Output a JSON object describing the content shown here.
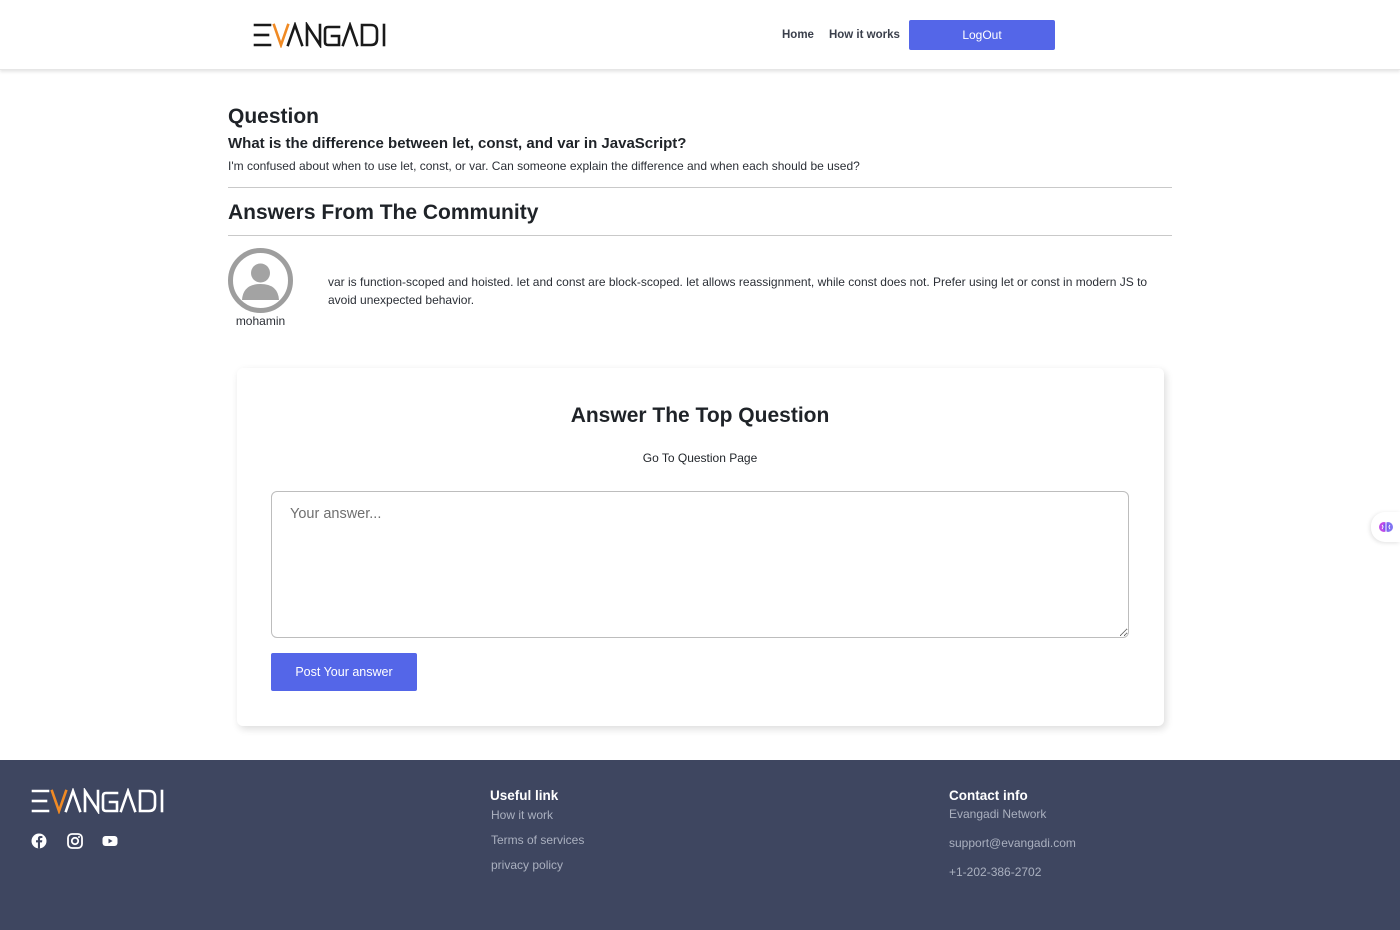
{
  "header": {
    "logo_text": "EVANGADI",
    "nav": {
      "home": "Home",
      "how_it_works": "How it works"
    },
    "logout_label": "LogOut"
  },
  "question": {
    "heading": "Question",
    "title": "What is the difference between let, const, and var in JavaScript?",
    "description": "I'm confused about when to use let, const, or var. Can someone explain the difference and when each should be used?"
  },
  "answers": {
    "heading": "Answers From The Community",
    "items": [
      {
        "username": "mohamin",
        "text": "var is function-scoped and hoisted. let and const are block-scoped. let allows reassignment, while const does not. Prefer using let or const in modern JS to avoid unexpected behavior."
      }
    ]
  },
  "answer_form": {
    "title": "Answer The Top Question",
    "link": "Go To Question Page",
    "placeholder": "Your answer...",
    "submit_label": "Post Your answer"
  },
  "footer": {
    "logo_text": "EVANGADI",
    "social_icons": [
      "facebook-icon",
      "instagram-icon",
      "youtube-icon"
    ],
    "useful_links": {
      "title": "Useful link",
      "items": [
        "How it work",
        "Terms of services",
        "privacy policy"
      ]
    },
    "contact": {
      "title": "Contact info",
      "items": [
        "Evangadi Network",
        "support@evangadi.com",
        "+1-202-386-2702"
      ]
    }
  },
  "colors": {
    "primary_button": "#5466e8",
    "footer_bg": "#3e4660",
    "logo_accent": "#f08a24"
  }
}
